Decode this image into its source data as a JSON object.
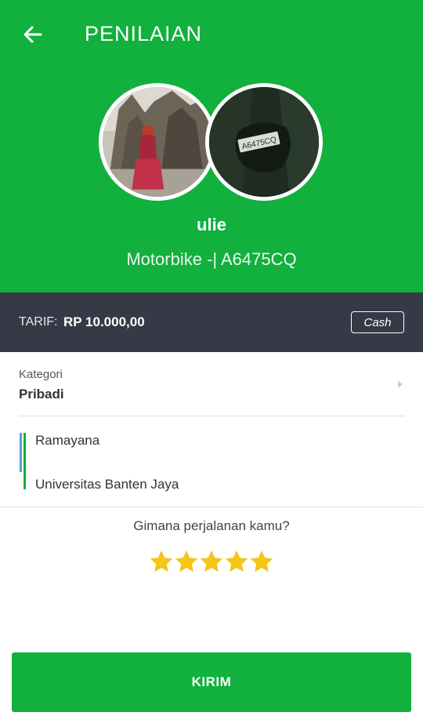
{
  "header": {
    "title": "PENILAIAN",
    "back_icon": "arrow-left-icon",
    "background_color": "#12b03d"
  },
  "driver": {
    "name": "ulie",
    "vehicle": "Motorbike -| A6475CQ",
    "plate": "A6475CQ"
  },
  "fare": {
    "label": "TARIF:",
    "value": "RP 10.000,00",
    "payment_method": "Cash",
    "background_color": "#363a46"
  },
  "category": {
    "label": "Kategori",
    "value": "Pribadi",
    "arrow_icon": "chevron-right-icon"
  },
  "route": {
    "origin": "Ramayana",
    "destination": "Universitas Banten Jaya",
    "origin_color": "#5b9bd5",
    "destination_color": "#12b03d"
  },
  "rating": {
    "question": "Gimana perjalanan kamu?",
    "value": 5,
    "max": 5,
    "star_color": "#f5c518",
    "star_icon": "star-icon"
  },
  "submit": {
    "label": "KIRIM"
  }
}
